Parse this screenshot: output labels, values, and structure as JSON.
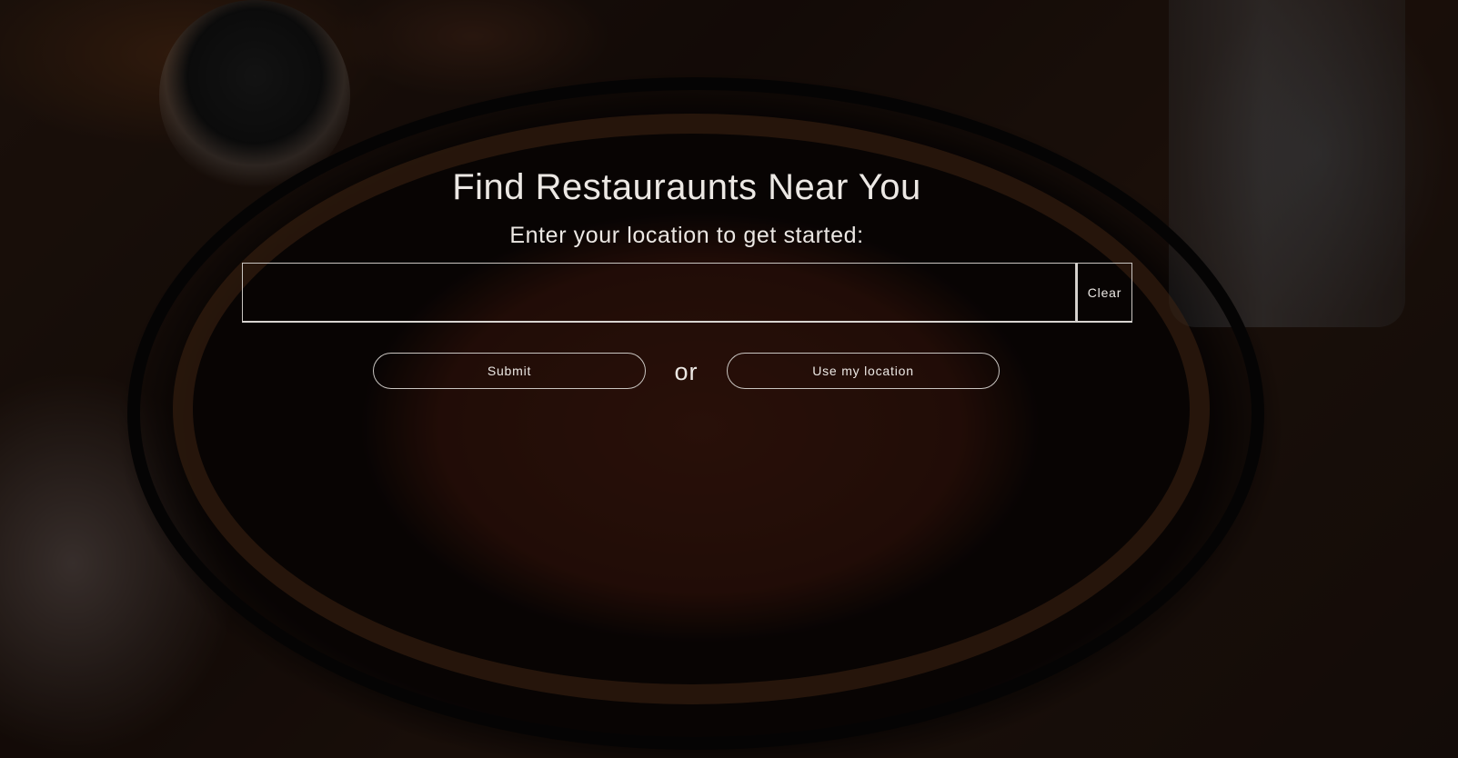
{
  "hero": {
    "title": "Find Restauraunts Near You",
    "subtitle": "Enter your location to get started:"
  },
  "search": {
    "value": "",
    "placeholder": "",
    "clear_label": "Clear"
  },
  "actions": {
    "submit_label": "Submit",
    "separator": "or",
    "use_location_label": "Use my location"
  },
  "colors": {
    "text": "#ece8e4",
    "border": "#c9c5c1",
    "overlay": "rgba(0,0,0,0.55)"
  }
}
